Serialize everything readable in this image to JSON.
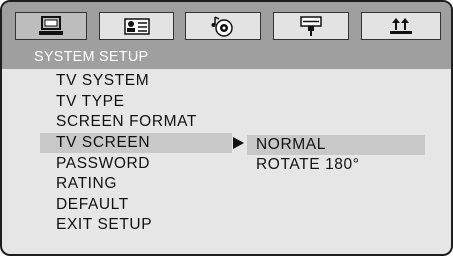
{
  "tabs": [
    {
      "icon": "monitor-icon",
      "active": true
    },
    {
      "icon": "person-card-icon",
      "active": false
    },
    {
      "icon": "music-disc-icon",
      "active": false
    },
    {
      "icon": "speaker-icon",
      "active": false
    },
    {
      "icon": "settings-sliders-icon",
      "active": false
    }
  ],
  "header": {
    "title": "SYSTEM SETUP"
  },
  "menu": {
    "items": [
      {
        "label": "TV SYSTEM"
      },
      {
        "label": "TV TYPE"
      },
      {
        "label": "SCREEN FORMAT"
      },
      {
        "label": "TV SCREEN"
      },
      {
        "label": "PASSWORD"
      },
      {
        "label": "RATING"
      },
      {
        "label": "DEFAULT"
      },
      {
        "label": "EXIT SETUP"
      }
    ],
    "selected": "TV SCREEN"
  },
  "submenu": {
    "options": [
      {
        "label": "NORMAL"
      },
      {
        "label": "ROTATE 180°"
      }
    ],
    "selected": "NORMAL"
  },
  "colors": {
    "bar": "#9f9f9f",
    "panel": "#e6e6e6",
    "highlight": "#c8c8c8",
    "text": "#111111",
    "header_text": "#ffffff"
  }
}
